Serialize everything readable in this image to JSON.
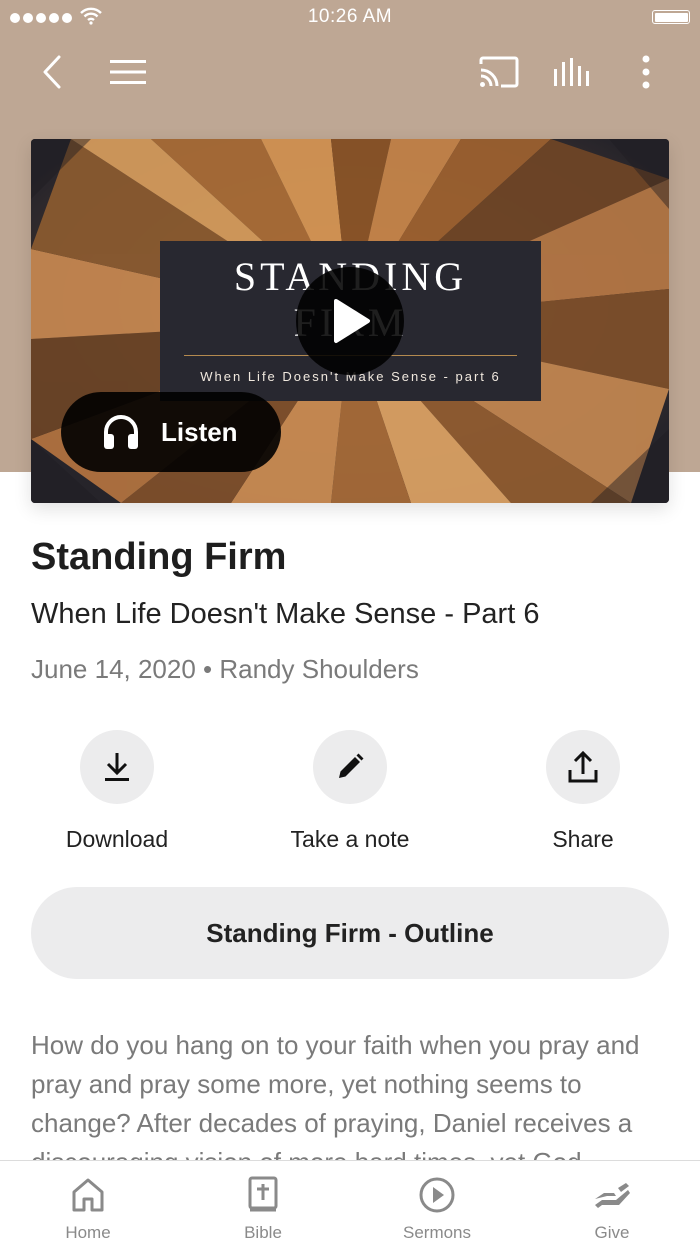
{
  "status_bar": {
    "time": "10:26 AM"
  },
  "nav": {
    "back_icon": "chevron-left-icon",
    "menu_icon": "hamburger-menu-icon",
    "cast_icon": "cast-icon",
    "equalizer_icon": "equalizer-icon",
    "more_icon": "more-vertical-icon"
  },
  "media": {
    "artwork_title_line1": "STANDING",
    "artwork_title_line2": "FIRM",
    "artwork_subtitle": "When Life Doesn't Make Sense - part 6",
    "listen_label": "Listen"
  },
  "sermon": {
    "title": "Standing Firm",
    "subtitle": "When Life Doesn't Make Sense - Part 6",
    "meta": "June 14, 2020 • Randy Shoulders"
  },
  "actions": [
    {
      "label": "Download",
      "icon": "download-icon"
    },
    {
      "label": "Take a note",
      "icon": "pencil-icon"
    },
    {
      "label": "Share",
      "icon": "share-icon"
    }
  ],
  "outline_button": "Standing Firm - Outline",
  "description": "How do you hang on to your faith when you pray and pray and pray some more, yet nothing seems to change? After decades of praying, Daniel receives a discouraging vision of more hard times, yet God",
  "tabs": [
    {
      "label": "Home",
      "icon": "home-icon"
    },
    {
      "label": "Bible",
      "icon": "bible-icon"
    },
    {
      "label": "Sermons",
      "icon": "play-circle-icon"
    },
    {
      "label": "Give",
      "icon": "give-hand-icon"
    }
  ],
  "colors": {
    "header_bg": "#bea794",
    "button_bg": "#ececed",
    "accent_line": "#b48a4f"
  }
}
